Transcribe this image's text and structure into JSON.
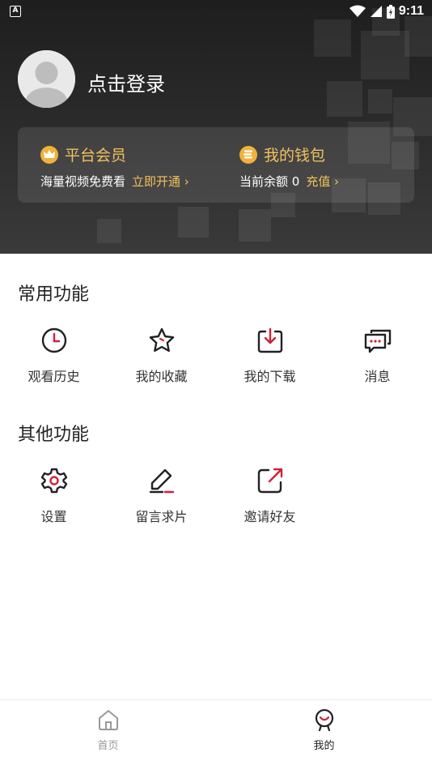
{
  "status_bar": {
    "app_icon_letter": "A",
    "time": "9:11"
  },
  "profile": {
    "login_text": "点击登录"
  },
  "membership_card": {
    "vip": {
      "title": "平台会员",
      "subtitle": "海量视频免费看",
      "link": "立即开通 ›"
    },
    "wallet": {
      "title": "我的钱包",
      "balance_text": "当前余额 0",
      "link": "充值 ›"
    }
  },
  "common_functions": {
    "title": "常用功能",
    "items": [
      {
        "label": "观看历史",
        "icon": "clock-icon"
      },
      {
        "label": "我的收藏",
        "icon": "star-icon"
      },
      {
        "label": "我的下载",
        "icon": "download-icon"
      },
      {
        "label": "消息",
        "icon": "message-icon"
      }
    ]
  },
  "other_functions": {
    "title": "其他功能",
    "items": [
      {
        "label": "设置",
        "icon": "gear-icon"
      },
      {
        "label": "留言求片",
        "icon": "edit-icon"
      },
      {
        "label": "邀请好友",
        "icon": "share-icon"
      }
    ]
  },
  "bottom_nav": {
    "items": [
      {
        "label": "首页",
        "icon": "home-icon",
        "active": false
      },
      {
        "label": "我的",
        "icon": "profile-face-icon",
        "active": true
      }
    ]
  },
  "colors": {
    "accent_gold": "#f2c15c",
    "accent_red": "#d0213a",
    "header_dark": "#222222",
    "inactive_gray": "#999999"
  }
}
